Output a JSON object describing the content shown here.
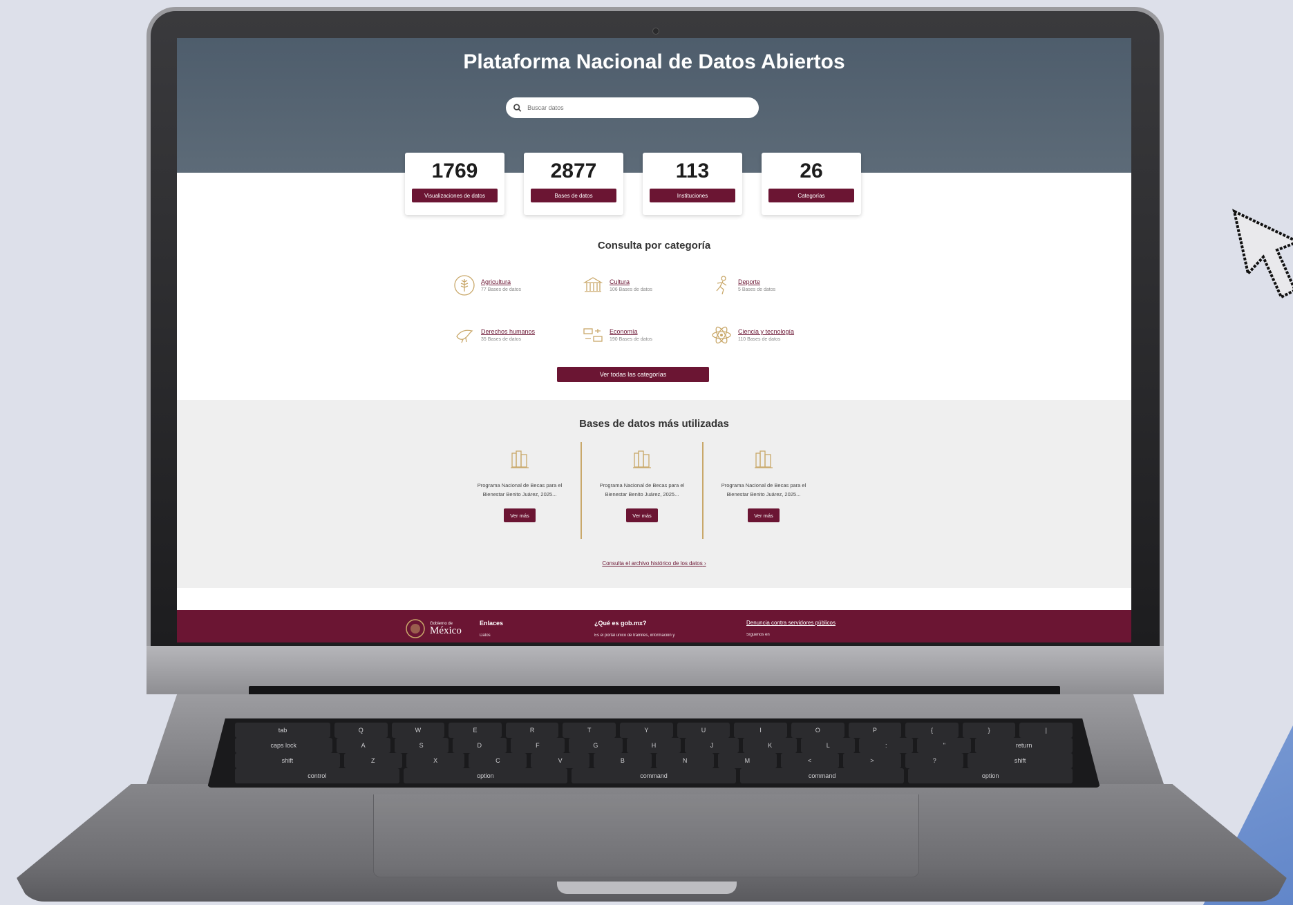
{
  "site": {
    "title": "Plataforma Nacional de Datos Abiertos",
    "search_placeholder": "Buscar datos"
  },
  "stats": [
    {
      "value": "1769",
      "label": "Visualizaciones de datos"
    },
    {
      "value": "2877",
      "label": "Bases de datos"
    },
    {
      "value": "113",
      "label": "Instituciones"
    },
    {
      "value": "26",
      "label": "Categorías"
    }
  ],
  "categories": {
    "title": "Consulta por categoría",
    "items": [
      {
        "name": "Agricultura",
        "count": "77 Bases de datos",
        "icon": "wheat-icon"
      },
      {
        "name": "Cultura",
        "count": "106 Bases de datos",
        "icon": "museum-icon"
      },
      {
        "name": "Deporte",
        "count": "5 Bases de datos",
        "icon": "runner-icon"
      },
      {
        "name": "Derechos humanos",
        "count": "35 Bases de datos",
        "icon": "dove-icon"
      },
      {
        "name": "Economía",
        "count": "190 Bases de datos",
        "icon": "money-exchange-icon"
      },
      {
        "name": "Ciencia y tecnología",
        "count": "110 Bases de datos",
        "icon": "atom-icon"
      }
    ],
    "view_all": "Ver todas las categorías"
  },
  "popular": {
    "title": "Bases de datos más utilizadas",
    "items": [
      {
        "title": "Programa Nacional de Becas para el Bienestar Benito Juárez, 2025...",
        "button": "Ver más"
      },
      {
        "title": "Programa Nacional de Becas para el Bienestar Benito Juárez, 2025...",
        "button": "Ver más"
      },
      {
        "title": "Programa Nacional de Becas para el Bienestar Benito Juárez, 2025...",
        "button": "Ver más"
      }
    ],
    "archive_link": "Consulta el archivo histórico de los datos"
  },
  "footer": {
    "logo_small": "Gobierno de",
    "logo_big": "México",
    "enlaces": "Enlaces",
    "enlaces_sub": "Datos",
    "que_es": "¿Qué es gob.mx?",
    "que_es_sub": "Es el portal único de trámites, información y",
    "denuncia": "Denuncia contra servidores públicos",
    "siguenos": "Síguenos en"
  },
  "colors": {
    "brand": "#6b1533",
    "hero": "#4e5d6c",
    "gold": "#c9a86a"
  },
  "keyboard": {
    "rows": [
      [
        "tab",
        "Q",
        "W",
        "E",
        "R",
        "T",
        "Y",
        "U",
        "I",
        "O",
        "P",
        "{",
        "}",
        "|"
      ],
      [
        "caps lock",
        "A",
        "S",
        "D",
        "F",
        "G",
        "H",
        "J",
        "K",
        "L",
        ":",
        "\"",
        "return"
      ],
      [
        "shift",
        "Z",
        "X",
        "C",
        "V",
        "B",
        "N",
        "M",
        "<",
        ">",
        "?",
        "shift"
      ],
      [
        "control",
        "option",
        "command",
        "command",
        "option"
      ]
    ]
  }
}
